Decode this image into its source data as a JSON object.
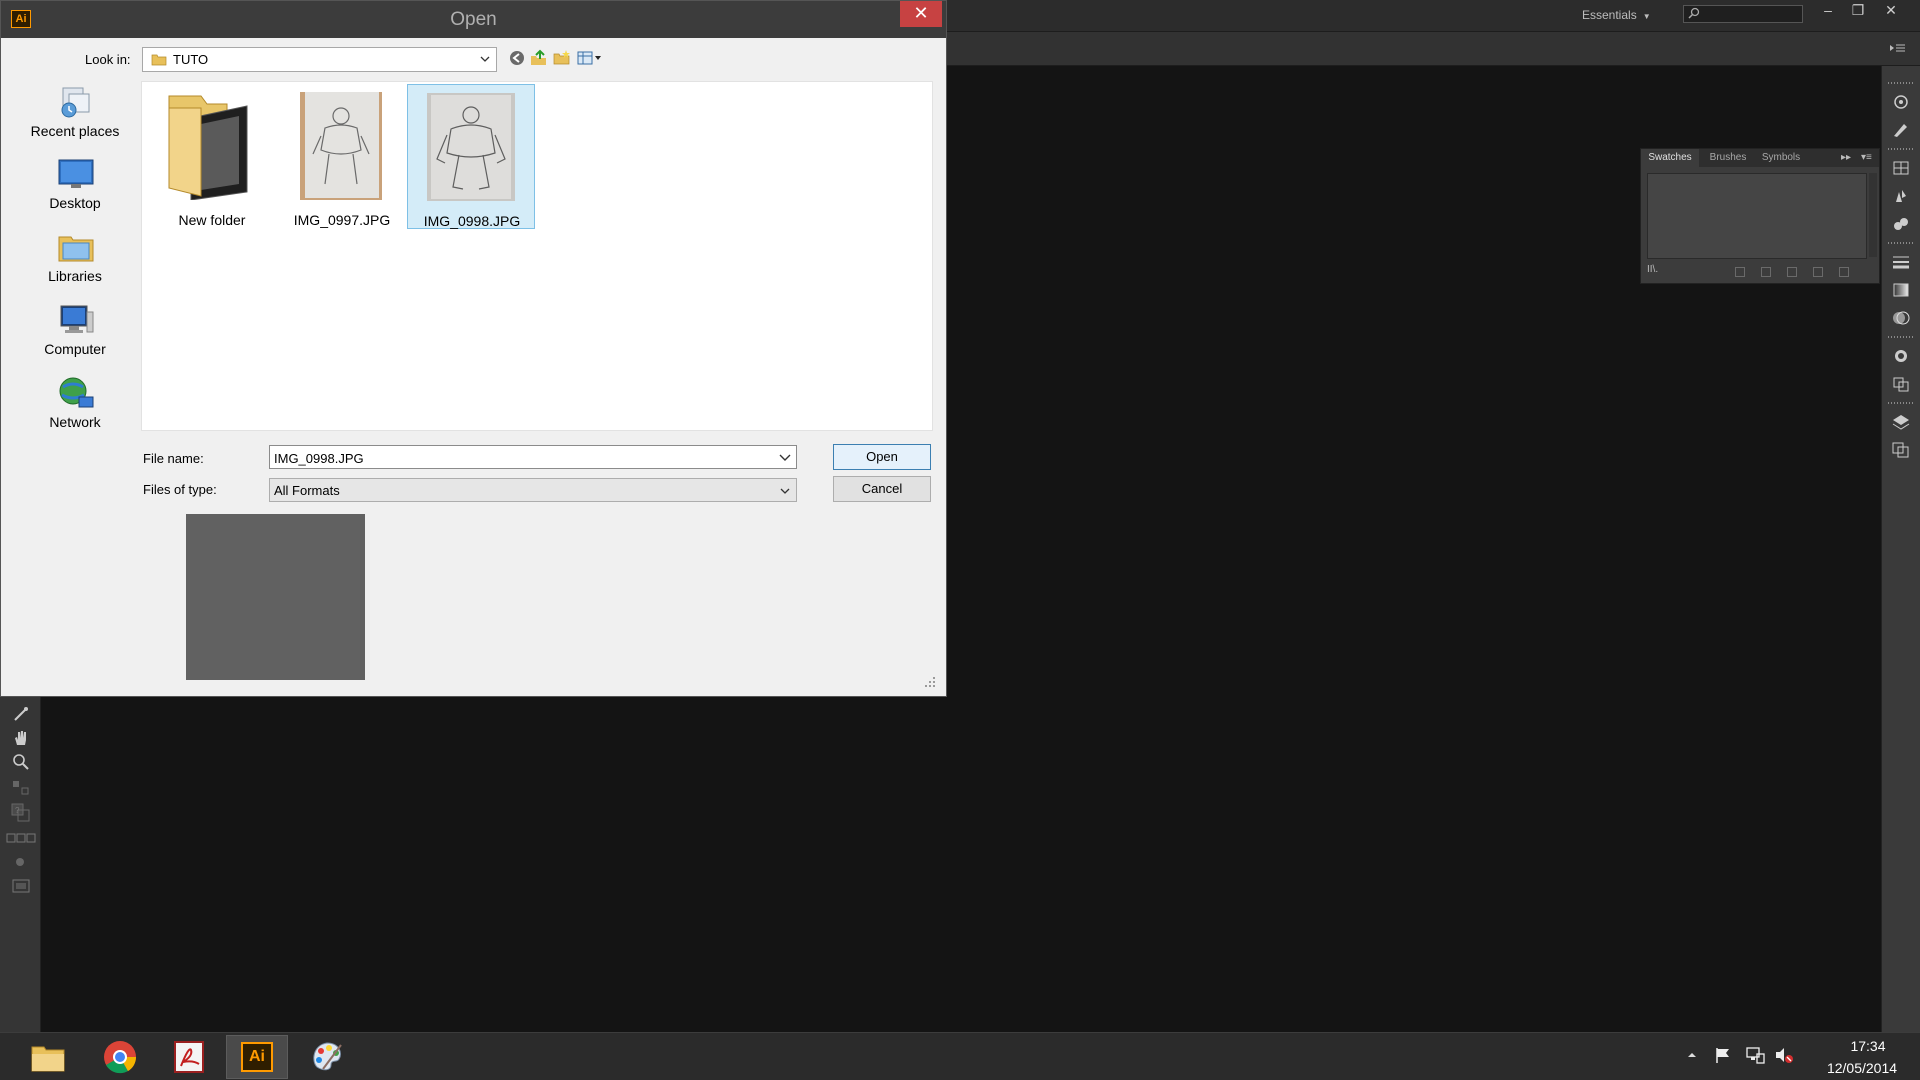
{
  "app": {
    "workspace_label": "Essentials",
    "panel_tabs": [
      "Swatches",
      "Brushes",
      "Symbols"
    ]
  },
  "dialog": {
    "title": "Open",
    "app_icon_text": "Ai",
    "look_in_label": "Look in:",
    "look_in_value": "TUTO",
    "places": [
      "Recent places",
      "Desktop",
      "Libraries",
      "Computer",
      "Network"
    ],
    "files": [
      {
        "name": "New folder",
        "kind": "folder",
        "selected": false
      },
      {
        "name": "IMG_0997.JPG",
        "kind": "image",
        "selected": false
      },
      {
        "name": "IMG_0998.JPG",
        "kind": "image",
        "selected": true
      }
    ],
    "file_name_label": "File name:",
    "file_name_value": "IMG_0998.JPG",
    "file_type_label": "Files of type:",
    "file_type_value": "All Formats",
    "open_label": "Open",
    "cancel_label": "Cancel"
  },
  "taskbar": {
    "apps": [
      "file-explorer",
      "chrome",
      "acrobat",
      "illustrator",
      "paint"
    ],
    "active_app": "illustrator",
    "illustrator_label": "Ai",
    "time": "17:34",
    "date": "12/05/2014"
  },
  "colors": {
    "accent_selection": "#d4ecf8",
    "close_red": "#c74242",
    "ai_orange": "#ff9a00"
  }
}
